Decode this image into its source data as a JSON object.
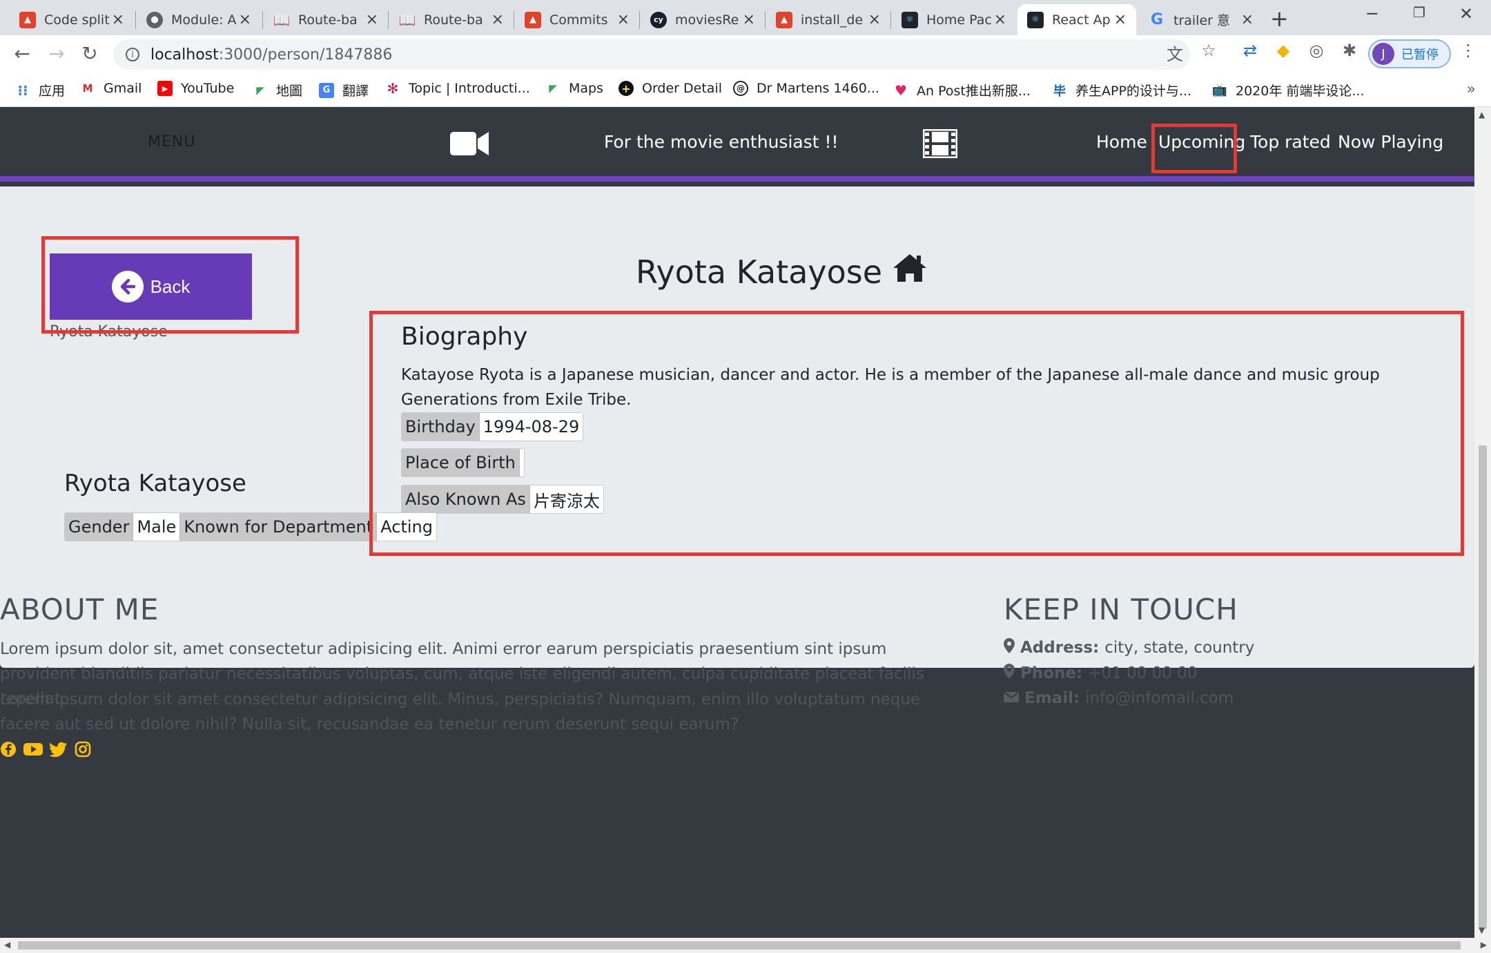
{
  "browser": {
    "tabs": [
      {
        "title": "Code split",
        "icon": "gitlab-icon",
        "color": "#e24329"
      },
      {
        "title": "Module: A",
        "icon": "globe-icon",
        "color": "#5f6368"
      },
      {
        "title": "Route-ba",
        "icon": "book-icon",
        "color": "#3c4043"
      },
      {
        "title": "Route-ba",
        "icon": "book-icon",
        "color": "#3c4043"
      },
      {
        "title": "Commits",
        "icon": "gitlab-icon",
        "color": "#e24329"
      },
      {
        "title": "moviesRe",
        "icon": "cypress-icon",
        "color": "#1b1e2e"
      },
      {
        "title": "install_de",
        "icon": "gitlab-icon",
        "color": "#e24329"
      },
      {
        "title": "Home Pac",
        "icon": "react-icon",
        "color": "#20232a"
      },
      {
        "title": "React Ap",
        "icon": "react-icon",
        "color": "#20232a"
      },
      {
        "title": "trailer 意",
        "icon": "google-icon",
        "color": "#4285f4"
      }
    ],
    "url_host": "localhost",
    "url_path": ":3000/person/1847886",
    "profile_initial": "J",
    "profile_label": "已暂停",
    "bookmarks": [
      {
        "label": "应用",
        "icon": "apps-icon"
      },
      {
        "label": "Gmail",
        "icon": "gmail-icon"
      },
      {
        "label": "YouTube",
        "icon": "youtube-icon"
      },
      {
        "label": "地圖",
        "icon": "maps-icon"
      },
      {
        "label": "翻譯",
        "icon": "translate-icon"
      },
      {
        "label": "Topic | Introducti...",
        "icon": "topic-icon"
      },
      {
        "label": "Maps",
        "icon": "maps-icon"
      },
      {
        "label": "Order Detail",
        "icon": "order-icon"
      },
      {
        "label": "Dr Martens 1460...",
        "icon": "drmartens-icon"
      },
      {
        "label": "An Post推出新服...",
        "icon": "heart-icon"
      },
      {
        "label": "养生APP的设计与...",
        "icon": "bi-icon"
      },
      {
        "label": "2020年 前端毕设论...",
        "icon": "bilibili-icon"
      }
    ]
  },
  "navbar": {
    "menu": "MENU",
    "tagline": "For the movie enthusiast !!",
    "links": [
      "Home",
      "Upcoming",
      "Top rated",
      "Now Playing"
    ],
    "accent": "#6f42c1"
  },
  "person": {
    "back_label": "Back",
    "image_alt": "Ryota Katayose",
    "name": "Ryota Katayose",
    "bio_heading": "Biography",
    "bio": "Katayose Ryota is a Japanese musician, dancer and actor. He is a member of the Japanese all-male dance and music group Generations from Exile Tribe.",
    "birthday_label": "Birthday",
    "birthday": "1994-08-29",
    "birthplace_label": "Place of Birth",
    "birthplace": "",
    "aka_label": "Also Known As",
    "aka": "片寄涼太",
    "gender_label": "Gender",
    "gender": "Male",
    "dept_label": "Known for Department",
    "dept": "Acting"
  },
  "footer": {
    "about_heading": "ABOUT ME",
    "about_p1": "Lorem ipsum dolor sit, amet consectetur adipisicing elit. Animi error earum perspiciatis praesentium sint ipsum provident blanditiis pariatur necessitatibus voluptas, cum, atque iste eligendi autem, culpa cupiditate placeat facilis repellat.",
    "about_p2": "Lorem ipsum dolor sit amet consectetur adipisicing elit. Minus, perspiciatis? Numquam, enim illo voluptatum neque facere aut sed ut dolore nihil? Nulla sit, recusandae ea tenetur rerum deserunt sequi earum?",
    "touch_heading": "KEEP IN TOUCH",
    "address_label": "Address:",
    "address": "city, state, country",
    "phone_label": "Phone:",
    "phone": "+01 00 00 00",
    "email_label": "Email:",
    "email": "info@infomail.com",
    "social_color": "#ffc107"
  },
  "colors": {
    "highlight": "#e53935",
    "button": "#673ab7"
  }
}
